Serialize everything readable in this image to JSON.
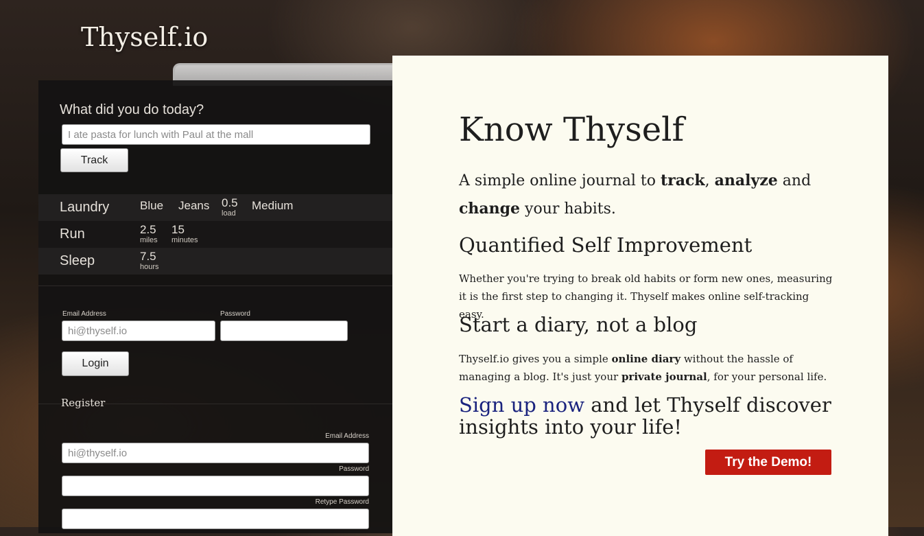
{
  "brand": {
    "logo": "Thyself.io"
  },
  "tracker": {
    "question": "What did you do today?",
    "placeholder": "I ate pasta for lunch with Paul at the mall",
    "track_label": "Track",
    "entries": [
      {
        "name": "Laundry",
        "cells": [
          {
            "value": "Blue",
            "unit": ""
          },
          {
            "value": "Jeans",
            "unit": ""
          },
          {
            "value": "0.5",
            "unit": "load"
          },
          {
            "value": "Medium",
            "unit": ""
          }
        ]
      },
      {
        "name": "Run",
        "cells": [
          {
            "value": "2.5",
            "unit": "miles"
          },
          {
            "value": "15",
            "unit": "minutes"
          }
        ]
      },
      {
        "name": "Sleep",
        "cells": [
          {
            "value": "7.5",
            "unit": "hours"
          }
        ]
      }
    ]
  },
  "login": {
    "email_label": "Email Address",
    "email_placeholder": "hi@thyself.io",
    "password_label": "Password",
    "login_label": "Login"
  },
  "register": {
    "title": "Register",
    "email_label": "Email Address",
    "email_placeholder": "hi@thyself.io",
    "password_label": "Password",
    "retype_label": "Retype Password"
  },
  "hero": {
    "title": "Know Thyself",
    "lead_pre": "A simple online journal to ",
    "lead_track": "track",
    "lead_comma": ", ",
    "lead_analyze": "analyze",
    "lead_and": " and ",
    "lead_change": "change",
    "lead_post": " your habits.",
    "h2_quantified": "Quantified Self Improvement",
    "p_quantified": "Whether you're trying to break old habits or form new ones, measuring it is the first step to changing it. Thyself makes online self-tracking easy.",
    "h2_diary": "Start a diary, not a blog",
    "p_diary_pre": "Thyself.io gives you a simple ",
    "p_diary_bold1": "online diary",
    "p_diary_mid": " without the hassle of managing a blog. It's just your ",
    "p_diary_bold2": "private journal",
    "p_diary_post": ", for your personal life.",
    "cta_link": "Sign up now",
    "cta_rest": " and let Thyself discover insights into your life!",
    "demo_label": "Try the Demo!"
  },
  "colors": {
    "accent": "#c31c12",
    "link": "#1a237e",
    "panel_dark": "#141212",
    "panel_light": "#fcfbf0"
  }
}
